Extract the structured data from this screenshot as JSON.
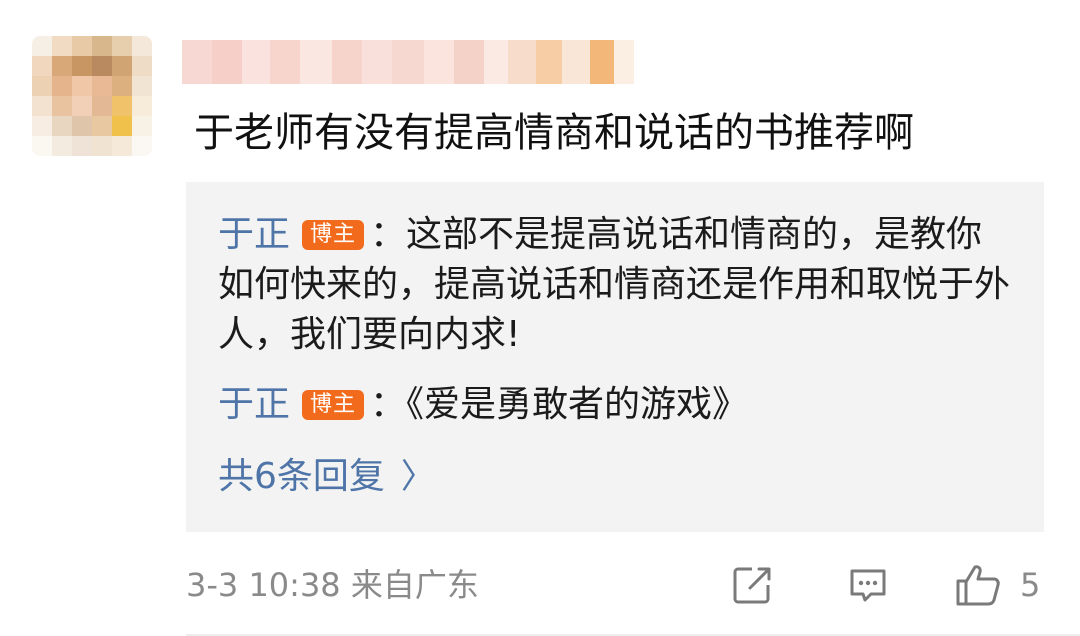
{
  "comment": {
    "text": "于老师有没有提高情商和说话的书推荐啊"
  },
  "replies": [
    {
      "author": "于正",
      "badge": "博主",
      "separator": "：",
      "text": "这部不是提高说话和情商的，是教你如何快来的，提高说话和情商还是作用和取悦于外人，我们要向内求!"
    },
    {
      "author": "于正",
      "badge": "博主",
      "separator": "：",
      "text": "《爱是勇敢者的游戏》"
    }
  ],
  "more_replies_label": "共6条回复",
  "more_replies_chevron": "〉",
  "footer": {
    "timestamp": "3-3 10:38",
    "location": "来自广东",
    "like_count": "5"
  },
  "icons": {
    "share": "share-edit-icon",
    "reply": "comment-bubble-icon",
    "like": "thumbs-up-icon",
    "more": "chevron-right-icon"
  },
  "colors": {
    "link_blue": "#4f75a8",
    "badge_orange": "#f26a1b",
    "reply_bg": "#f3f3f3",
    "meta_gray": "#8a8a8a"
  }
}
